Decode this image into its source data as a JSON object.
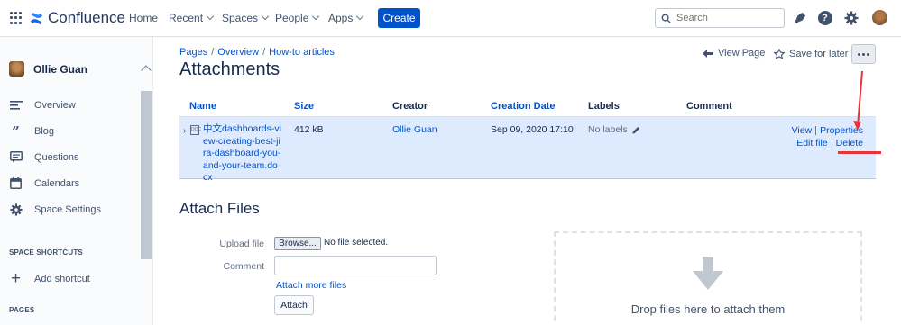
{
  "topnav": {
    "logo_text": "Confluence",
    "items": [
      {
        "label": "Home"
      },
      {
        "label": "Recent"
      },
      {
        "label": "Spaces"
      },
      {
        "label": "People"
      },
      {
        "label": "Apps"
      }
    ],
    "create_label": "Create",
    "search_placeholder": "Search",
    "icons": [
      "apps-grid-icon",
      "confluence-logo-icon",
      "notifications-icon",
      "help-icon",
      "settings-icon",
      "user-avatar"
    ]
  },
  "sidebar": {
    "user_name": "Ollie Guan",
    "items": [
      {
        "label": "Overview",
        "icon": "overview-icon"
      },
      {
        "label": "Blog",
        "icon": "quote-icon"
      },
      {
        "label": "Questions",
        "icon": "questions-icon"
      },
      {
        "label": "Calendars",
        "icon": "calendar-icon"
      },
      {
        "label": "Space Settings",
        "icon": "gear-icon"
      }
    ],
    "shortcuts_heading": "SPACE SHORTCUTS",
    "add_shortcut_label": "Add shortcut",
    "pages_heading": "PAGES"
  },
  "breadcrumb": [
    {
      "label": "Pages"
    },
    {
      "label": "Overview"
    },
    {
      "label": "How-to articles"
    }
  ],
  "breadcrumb_separator": "/",
  "page_title": "Attachments",
  "page_actions": {
    "view_page": "View Page",
    "save_for_later": "Save for later"
  },
  "table": {
    "headers": {
      "name": "Name",
      "size": "Size",
      "creator": "Creator",
      "creation_date": "Creation Date",
      "labels": "Labels",
      "comment": "Comment"
    },
    "rows": [
      {
        "file_icon_text": "DOC",
        "name": "中文dashboards-view-creating-best-jira-dashboard-you-and-your-team.docx",
        "size": "412 kB",
        "creator": "Ollie Guan",
        "creation_date": "Sep 09, 2020 17:10",
        "labels": "No labels",
        "actions": {
          "view": "View",
          "properties": "Properties",
          "edit_file": "Edit file",
          "delete": "Delete"
        }
      }
    ]
  },
  "attach_section": {
    "title": "Attach Files",
    "upload_label": "Upload file",
    "browse_label": "Browse...",
    "no_file": "No file selected.",
    "comment_label": "Comment",
    "attach_more": "Attach more files",
    "attach_button": "Attach",
    "drop_text": "Drop files here to attach them"
  },
  "colors": {
    "brand_blue": "#0052cc",
    "row_highlight": "#deebff",
    "annotation_red": "#e5343a"
  }
}
